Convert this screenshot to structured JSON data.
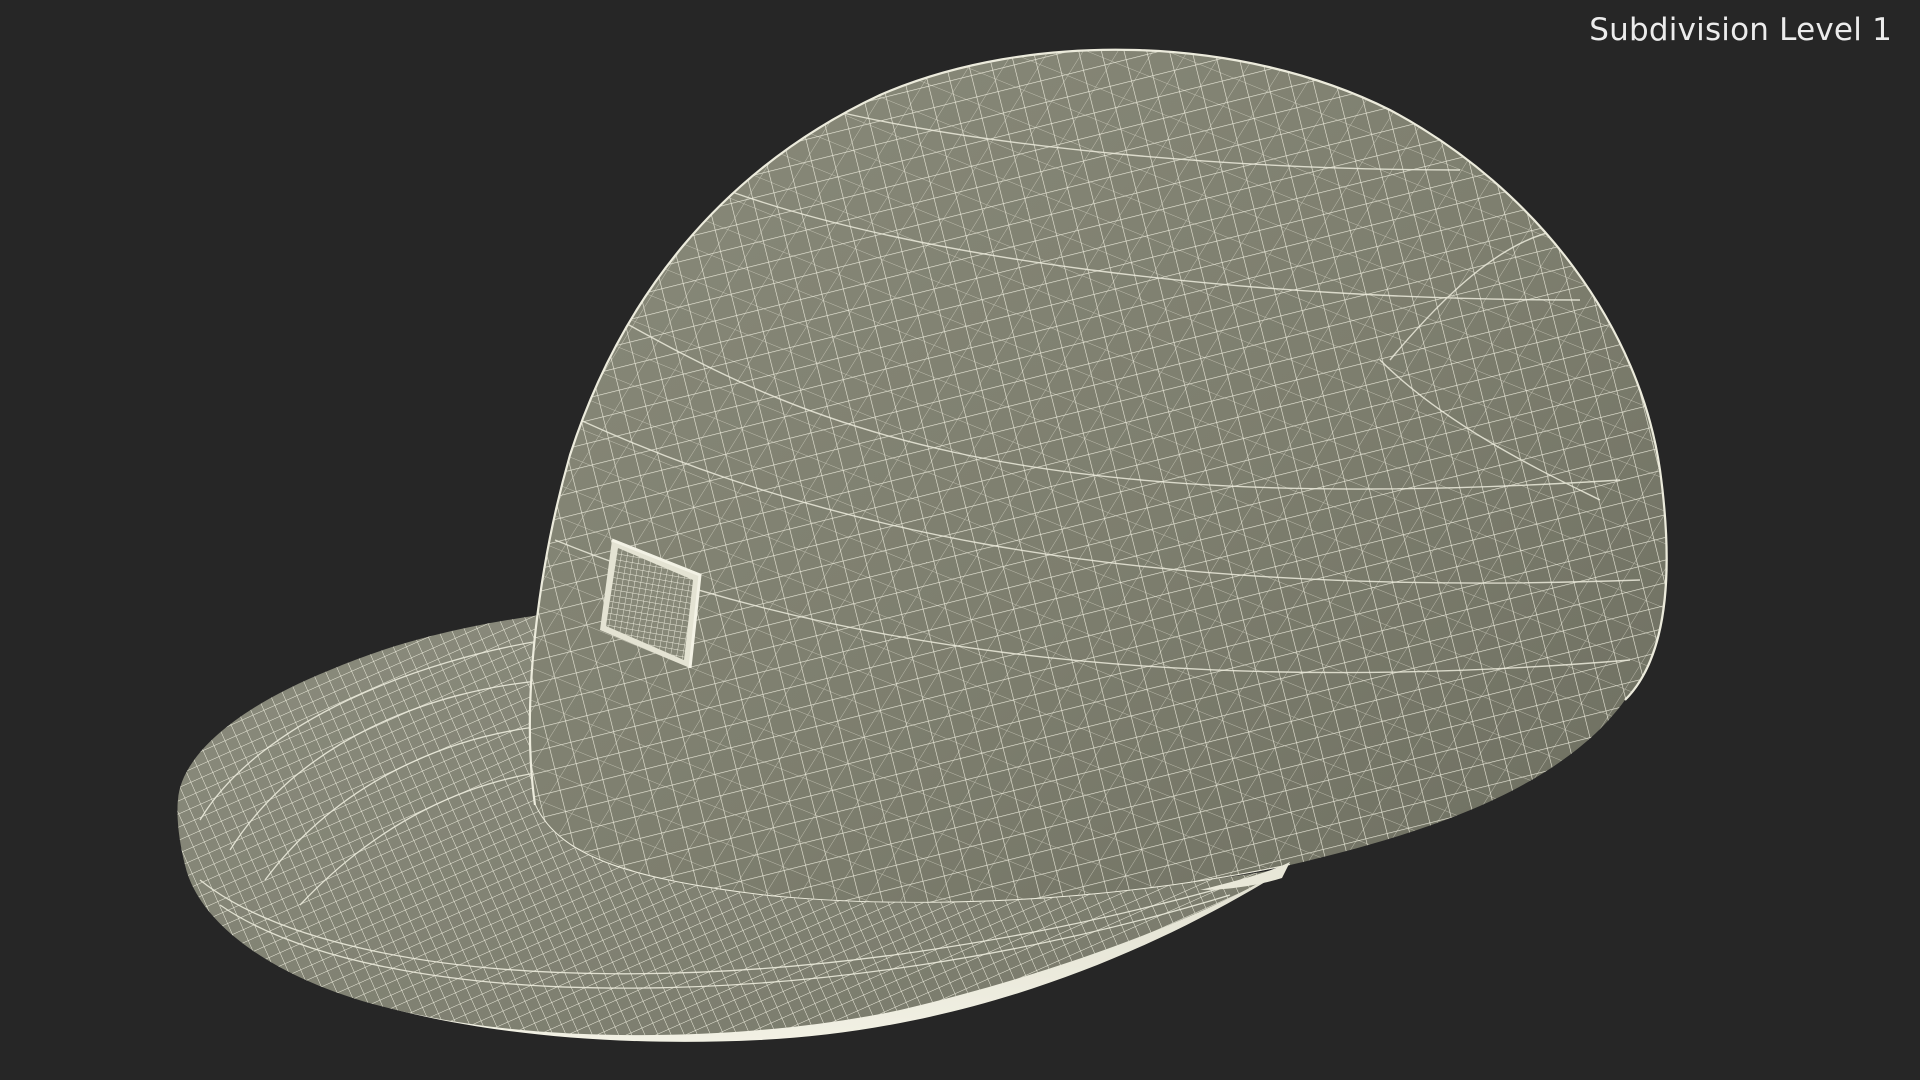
{
  "viewport": {
    "subdivision_label": "Subdivision Level 1",
    "background_color": "#262626",
    "mesh_fill_color": "#7d7e6e",
    "wire_color": "#ecebdc"
  },
  "model": {
    "object": "baseball-cap",
    "display_mode": "wireframe-on-shaded",
    "parts": [
      "crown",
      "brim",
      "front-patch"
    ]
  }
}
